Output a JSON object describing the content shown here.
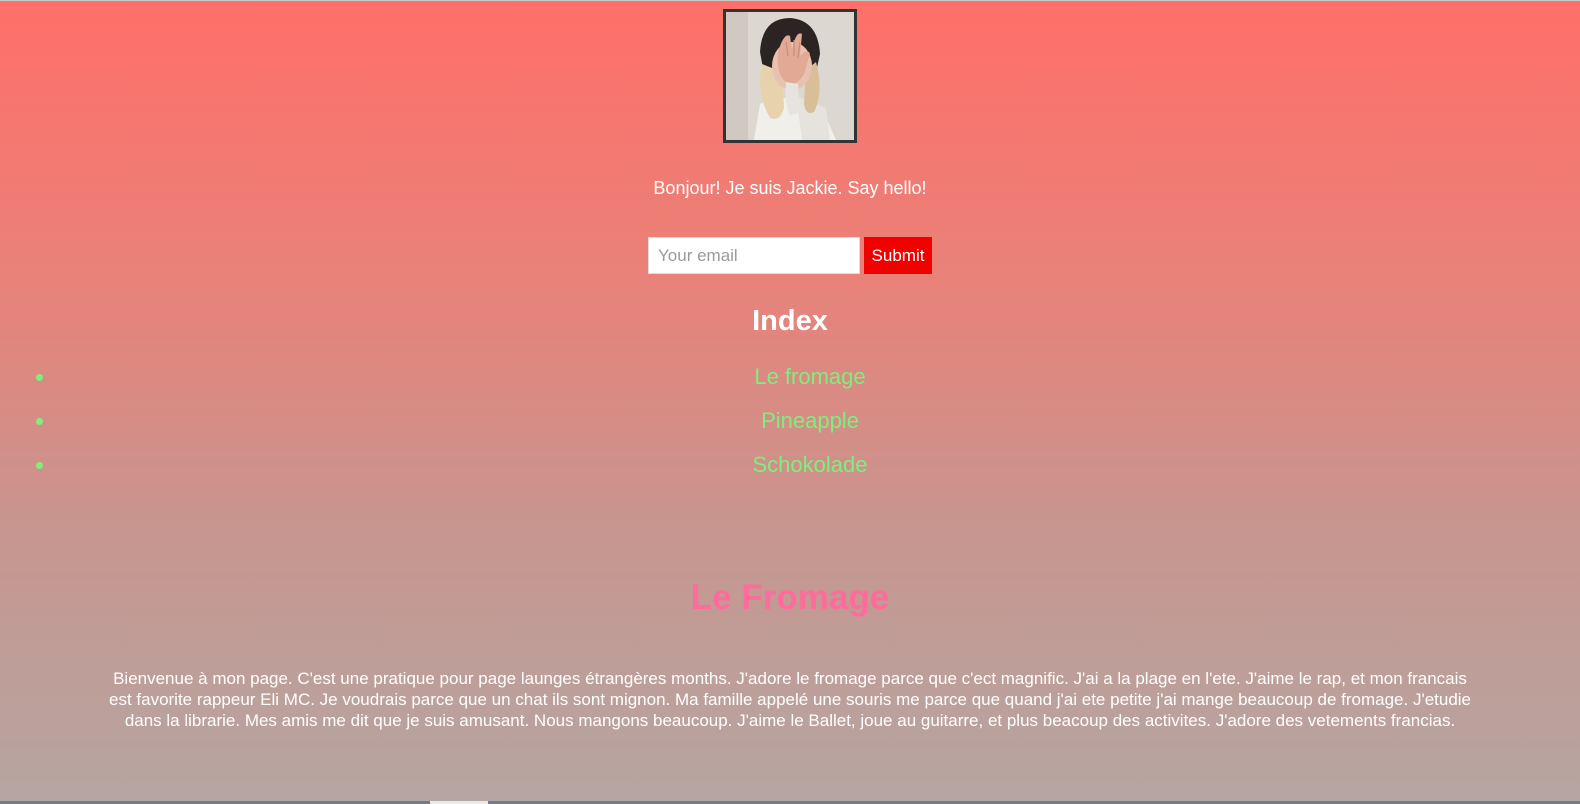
{
  "profile": {
    "greeting": "Bonjour! Je suis Jackie. Say hello!"
  },
  "email_form": {
    "placeholder": "Your email",
    "value": "",
    "submit_label": "Submit",
    "submit_color": "#f20000"
  },
  "index": {
    "heading": "Index",
    "items": [
      {
        "label": "Le fromage"
      },
      {
        "label": "Pineapple"
      },
      {
        "label": "Schokolade"
      }
    ],
    "link_color": "#7eef7e"
  },
  "section": {
    "title": "Le Fromage",
    "title_color": "#ff6b9b",
    "body": "Bienvenue à mon page. C'est une pratique pour page launges étrangères months. J'adore le fromage parce que c'ect magnific. J'ai a la plage en l'ete. J'aime le rap, et mon francais est favorite rappeur Eli MC. Je voudrais parce que un chat ils sont mignon. Ma famille appelé une souris me parce que quand j'ai ete petite j'ai mange beaucoup de fromage. J'etudie dans la librarie. Mes amis me dit que je suis amusant. Nous mangons beaucoup. J'aime le Ballet, joue au guitarre, et plus beacoup des activites. J'adore des vetements francias."
  },
  "theme": {
    "gradient_top": "#ff6f69",
    "gradient_bottom": "#b5a6a1",
    "text_color": "#ffffff"
  }
}
